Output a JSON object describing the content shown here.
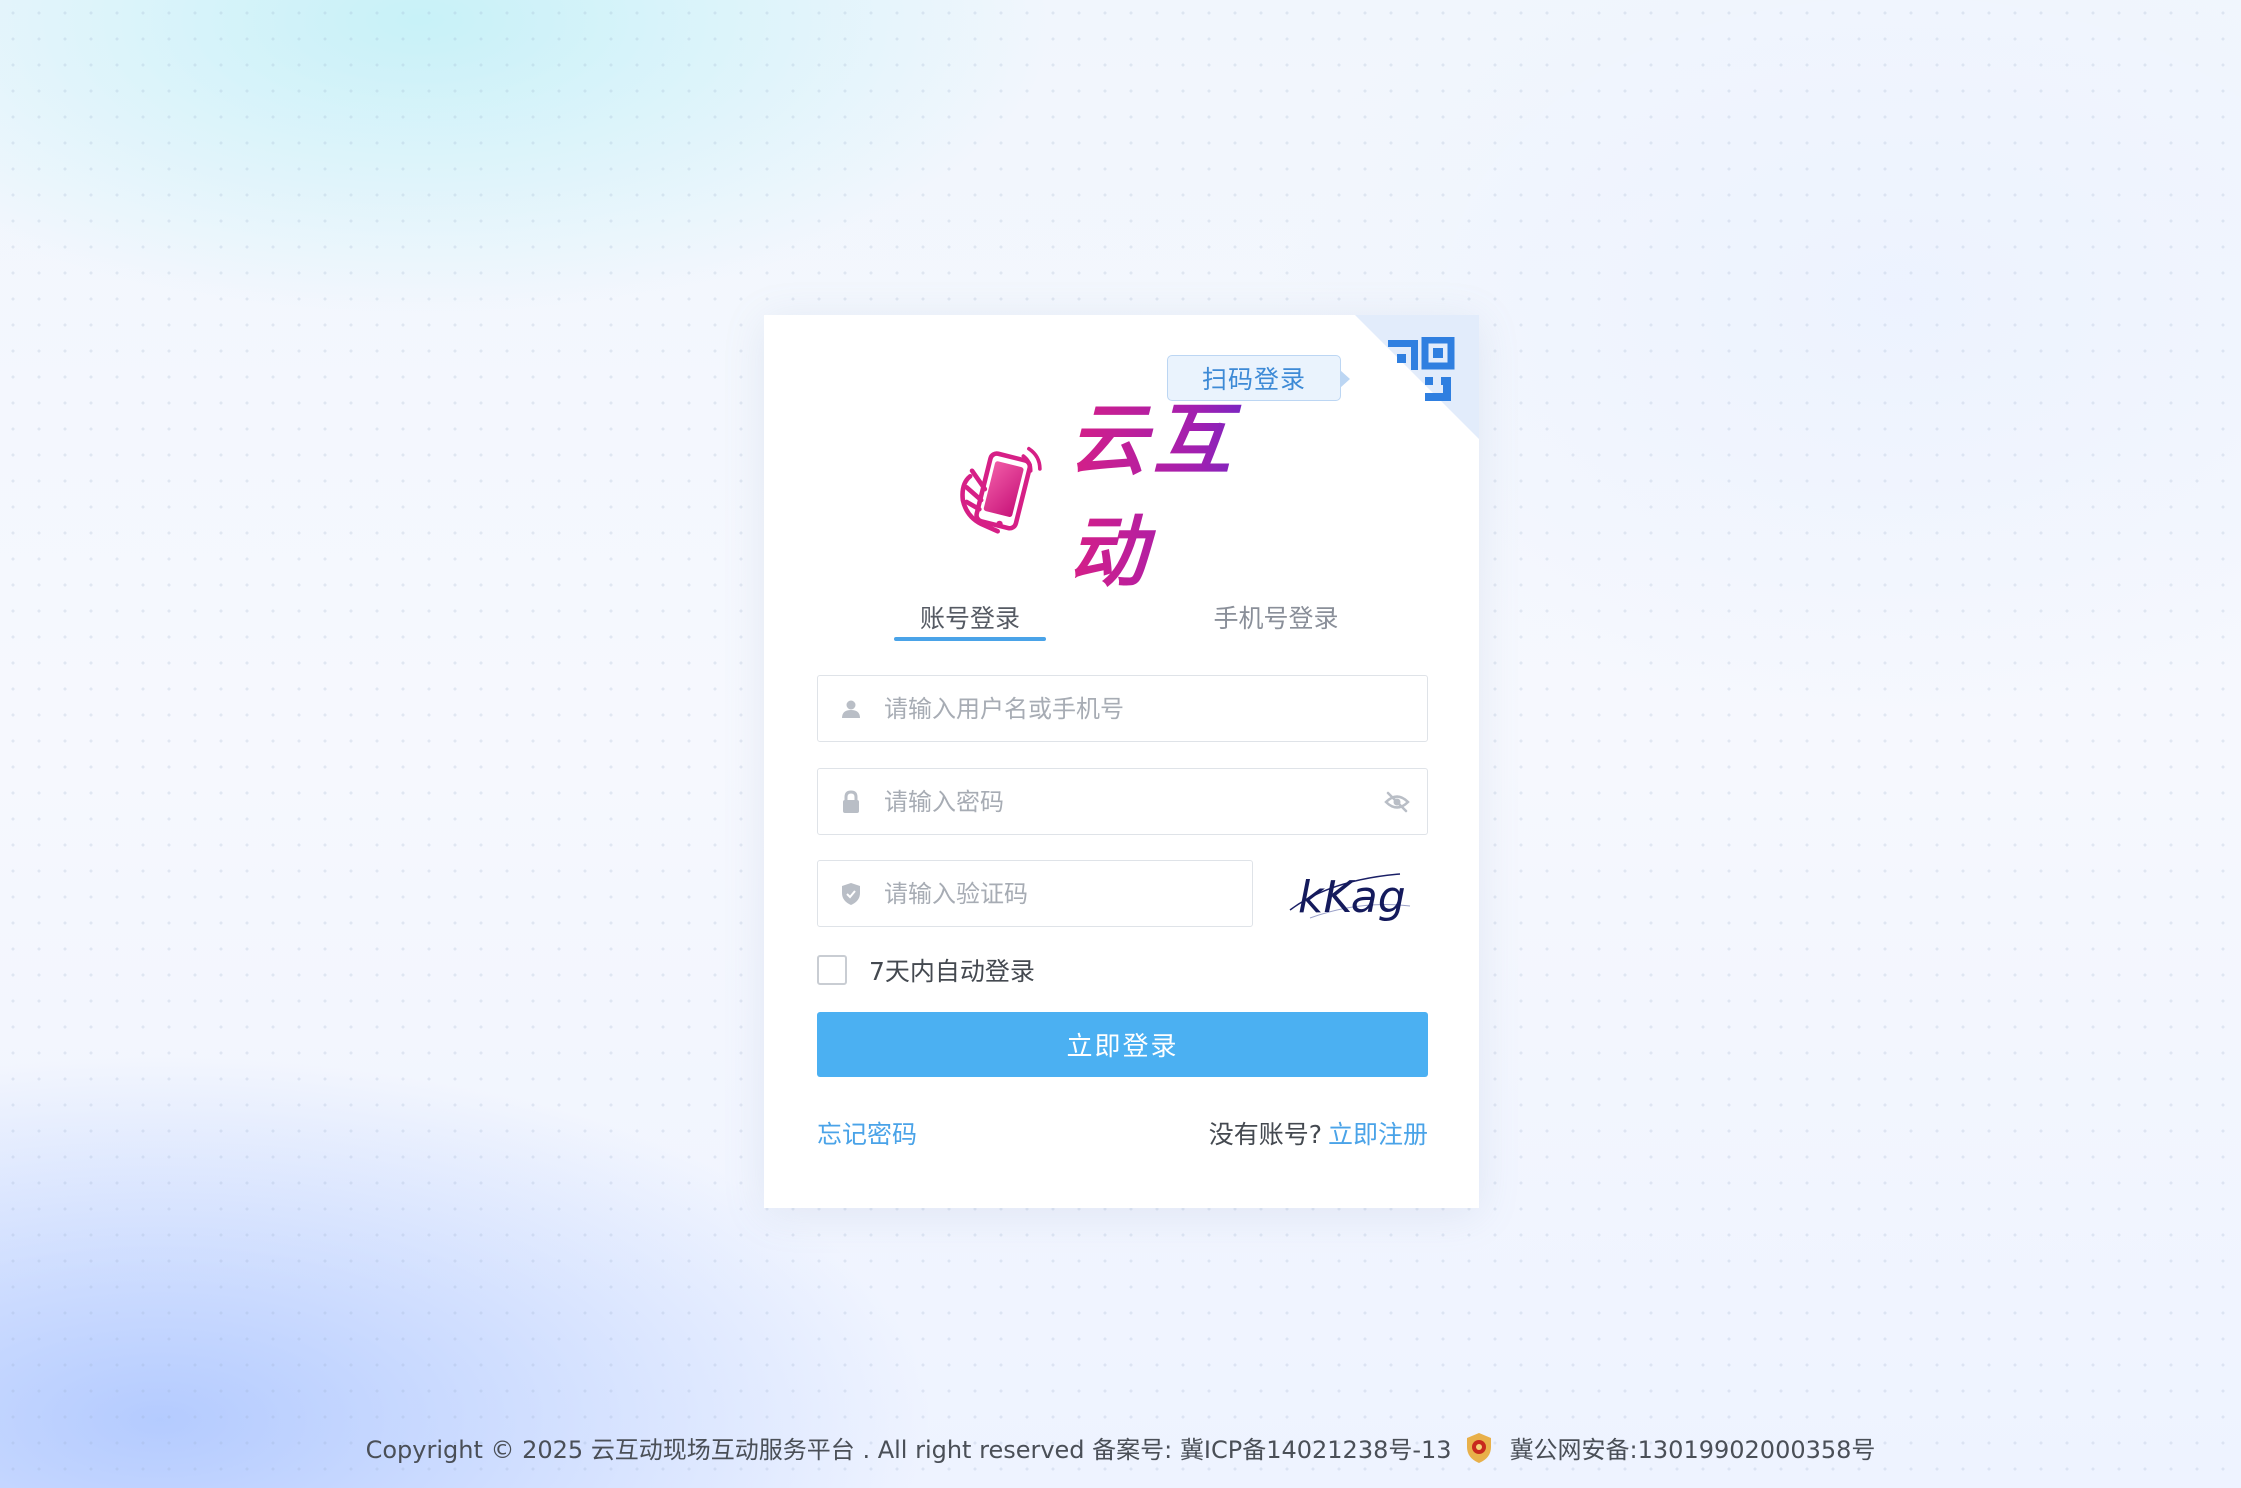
{
  "qr_login": {
    "tooltip": "扫码登录"
  },
  "brand": {
    "name": "云互动",
    "colors": {
      "gradient_start": "#d61f86",
      "gradient_mid": "#a21fb0",
      "gradient_end": "#4a2ed6"
    }
  },
  "tabs": [
    {
      "label": "账号登录",
      "active": true
    },
    {
      "label": "手机号登录",
      "active": false
    }
  ],
  "form": {
    "username": {
      "placeholder": "请输入用户名或手机号",
      "value": "",
      "icon": "user-icon"
    },
    "password": {
      "placeholder": "请输入密码",
      "value": "",
      "icon": "lock-icon",
      "toggle_icon": "eye-off-icon"
    },
    "captcha": {
      "placeholder": "请输入验证码",
      "value": "",
      "icon": "shield-icon",
      "image_text": "kKag"
    },
    "remember": {
      "label": "7天内自动登录",
      "checked": false
    },
    "submit_label": "立即登录"
  },
  "links": {
    "forgot": "忘记密码",
    "no_account": "没有账号?",
    "register": "立即注册"
  },
  "footer": {
    "copyright": "Copyright © 2025 云互动现场互动服务平台 . All right reserved 备案号: 冀ICP备14021238号-13",
    "police": "冀公网安备:13019902000358号"
  },
  "colors": {
    "accent": "#4aa3e8",
    "button": "#4bb0f2",
    "qr_corner": "#e2ecfb",
    "qr_icon": "#2f7fe0"
  }
}
